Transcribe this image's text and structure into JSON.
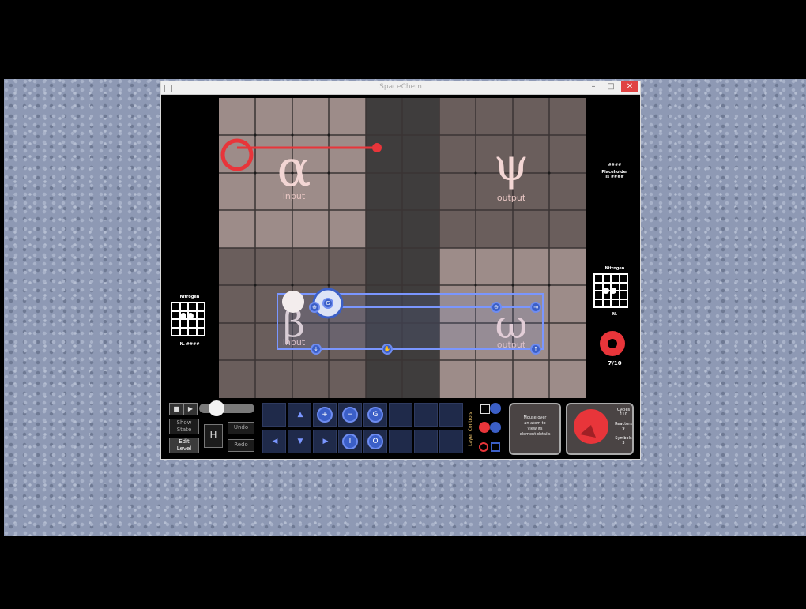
{
  "window": {
    "title": "SpaceChem",
    "minimize_glyph": "–",
    "maximize_glyph": "□",
    "close_glyph": "✕"
  },
  "board": {
    "zones": [
      {
        "symbol": "α",
        "label": "input"
      },
      {
        "symbol": "ψ",
        "label": "output"
      },
      {
        "symbol": "β",
        "label": "input"
      },
      {
        "symbol": "ω",
        "label": "output"
      }
    ]
  },
  "right_panel": {
    "header_label": "####",
    "header_sub": "Placeholder\nis ####",
    "molecule_title": "Nitrogen",
    "molecule_count_label": "N₂",
    "counter_value": "7/10"
  },
  "left_panel": {
    "molecule_title": "Nitrogen",
    "molecule_sub": "N₂ ####"
  },
  "toolbar": {
    "show_state_label": "Show\nState",
    "edit_level_label": "Edit\nLevel",
    "h_label": "H",
    "undo_label": "Undo",
    "redo_label": "Redo",
    "layer_controls_label": "Layer Controls",
    "info_text": "Mouse over\nan atom to\nview its\nelement details",
    "stats": [
      {
        "label": "Cycles",
        "value": "110"
      },
      {
        "label": "Reactors",
        "value": "9"
      },
      {
        "label": "Symbols",
        "value": "3"
      }
    ]
  },
  "colors": {
    "red_waldo": "#e8353a",
    "blue_waldo": "#3b5fc7",
    "zone_light": "#9d8c89",
    "zone_dark": "#3f3d3d",
    "zone_mid": "#6a5e5c"
  }
}
